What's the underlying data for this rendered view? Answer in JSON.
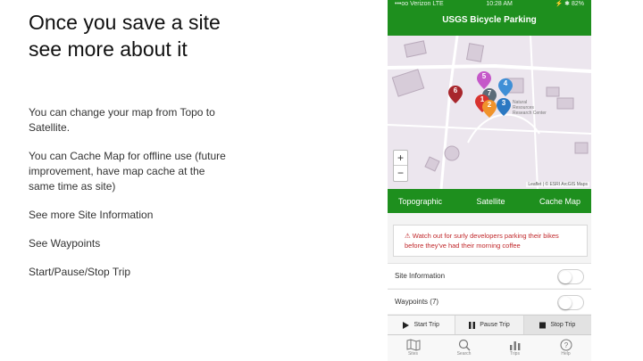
{
  "slide": {
    "title": "Once you save a site see more about it",
    "bullets": [
      "You can change your map from Topo to Satellite.",
      "You can Cache Map for offline use (future improvement, have map cache at the same time as site)",
      "See more Site Information",
      "See Waypoints",
      "Start/Pause/Stop Trip"
    ]
  },
  "phone": {
    "status": {
      "carrier": "•••oo Verizon LTE",
      "time": "10:28 AM",
      "battery": "⚡ ✱ 82%"
    },
    "nav_title": "USGS Bicycle Parking",
    "map": {
      "label": "Natural Resources Research Center",
      "zoom_in": "+",
      "zoom_out": "−",
      "attribution": "Leaflet | © ESRI ArcGIS Maps",
      "markers": [
        {
          "num": "5",
          "color": "#c558c9"
        },
        {
          "num": "4",
          "color": "#3f8fd6"
        },
        {
          "num": "6",
          "color": "#a8262c"
        },
        {
          "num": "7",
          "color": "#5b6b78"
        },
        {
          "num": "1",
          "color": "#d8332f"
        },
        {
          "num": "2",
          "color": "#f0932b"
        },
        {
          "num": "3",
          "color": "#2b78c2"
        }
      ]
    },
    "map_tabs": [
      "Topographic",
      "Satellite",
      "Cache Map"
    ],
    "alert": "⚠ Watch out for surly developers parking their bikes before they've had their morning coffee",
    "rows": {
      "site_info": "Site Information",
      "waypoints": "Waypoints (7)"
    },
    "trip": {
      "start": "Start Trip",
      "pause": "Pause Trip",
      "stop": "Stop Trip"
    },
    "tabs": [
      "Sites",
      "Search",
      "Trips",
      "Help"
    ]
  }
}
